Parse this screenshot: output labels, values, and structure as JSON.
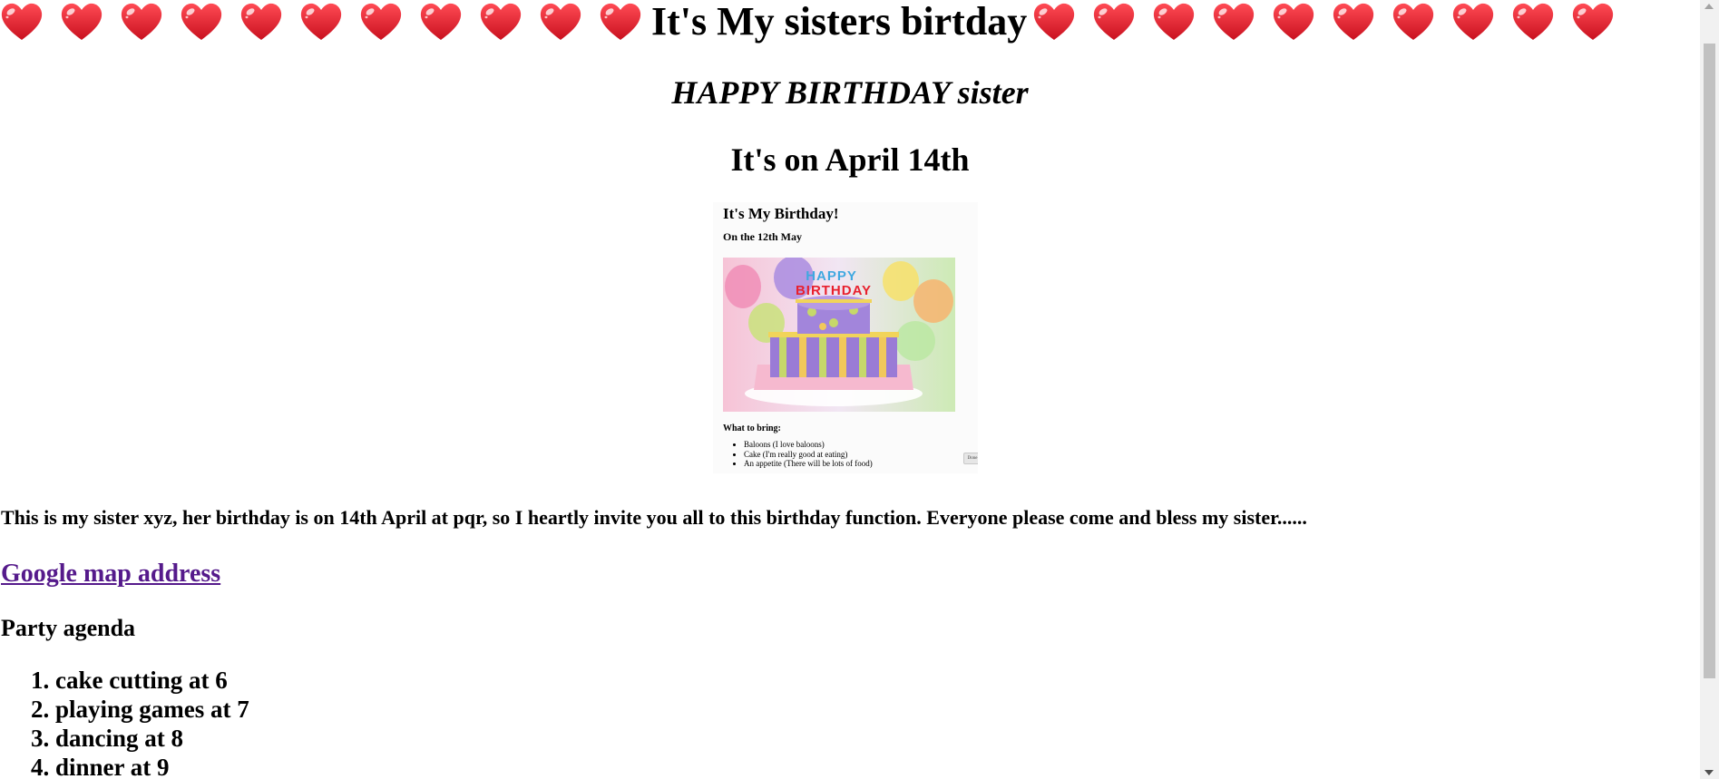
{
  "page": {
    "title": "It's My sisters birtday",
    "subtitle": "HAPPY BIRTHDAY sister",
    "date_heading": "It's on April 14th",
    "heart_icon": "heart-emoji",
    "heart_color": "#e8202e"
  },
  "invite_card": {
    "title": "It's My Birthday!",
    "date": "On the 12th May",
    "photo_text": "HAPPY BIRTHDAY",
    "bring_label": "What to bring:",
    "bring_items": [
      "Baloons (I love baloons)",
      "Cake (I'm really good at eating)",
      "An appetite (There will be lots of food)"
    ],
    "button_label": "Done"
  },
  "intro": "This is my sister xyz, her birthday is on 14th April at pqr, so I heartly invite you all to this birthday function. Everyone please come and bless my sister......",
  "map_link": "Google map address",
  "agenda": {
    "heading": "Party agenda",
    "items": [
      "cake cutting at 6",
      "playing games at 7",
      "dancing at 8",
      "dinner at 9"
    ]
  },
  "colors": {
    "link_visited": "#551a8b",
    "scrollbar_track": "#f1f1f1",
    "scrollbar_thumb": "#c1c1c1"
  }
}
